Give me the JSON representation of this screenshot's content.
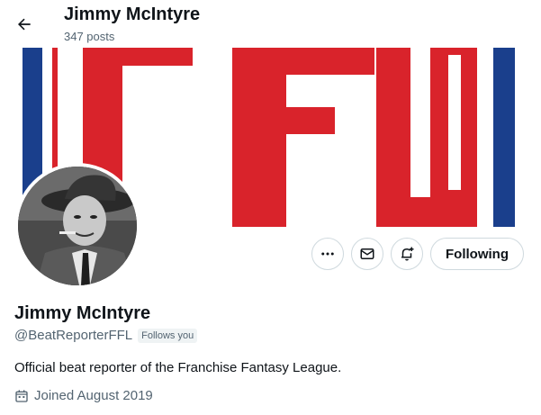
{
  "header": {
    "title": "Jimmy McIntyre",
    "post_count": "347 posts",
    "back_icon": "arrow-left-icon"
  },
  "banner": {
    "text": "FFL",
    "colors": {
      "red": "#d9232b",
      "blue": "#1a3f8c",
      "bg": "#ffffff"
    }
  },
  "actions": {
    "more_icon": "more-horizontal-icon",
    "message_icon": "envelope-icon",
    "notify_icon": "bell-plus-icon",
    "following_label": "Following"
  },
  "profile": {
    "name": "Jimmy McIntyre",
    "handle": "@BeatReporterFFL",
    "follows_you": "Follows you",
    "bio": "Official beat reporter of the Franchise Fantasy League.",
    "joined": "Joined August 2019",
    "joined_icon": "calendar-icon"
  }
}
